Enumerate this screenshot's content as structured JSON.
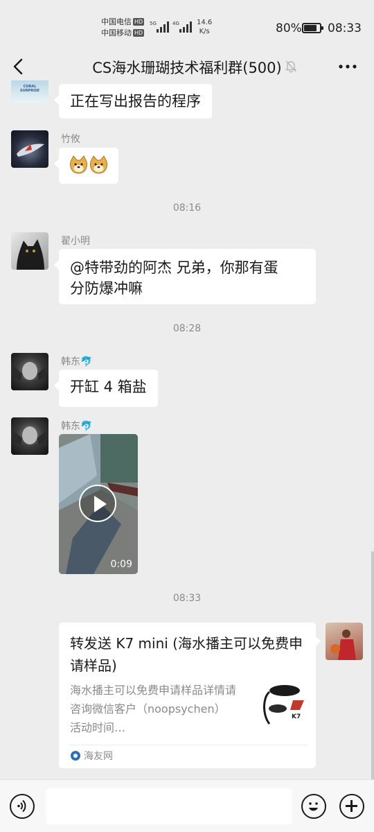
{
  "status_bar": {
    "carrier_1": "中国电信",
    "carrier_2": "中国移动",
    "hd_label": "HD",
    "net_1": "5G",
    "net_2": "4G",
    "speed_value": "14.6",
    "speed_unit": "K/s",
    "battery_percent": "80%",
    "battery_level": 0.8,
    "time": "08:33"
  },
  "header": {
    "title": "CS海水珊瑚技术福利群(500)",
    "icons": [
      "back-arrow-icon",
      "mute-bell-icon",
      "more-dots-icon"
    ]
  },
  "messages": {
    "m0": {
      "text": "正在写出报告的程序",
      "avatar_caption": "CORAL SURPRISE"
    },
    "m1": {
      "sender": "竹攸",
      "content": "emoji",
      "icons": [
        "doge-emoji-icon",
        "doge-emoji-icon"
      ]
    },
    "t1": "08:16",
    "m2": {
      "sender": "翟小明",
      "text_line_1": "@特带劲的阿杰  兄弟，你那有蛋",
      "text_line_2": "分防爆冲嘛"
    },
    "t2": "08:28",
    "m3": {
      "sender": "韩东🐬",
      "text": "开缸 4 箱盐"
    },
    "m4": {
      "sender": "韩东🐬",
      "video_duration": "0:09"
    },
    "t3": "08:33",
    "m5": {
      "title": "转发送 K7 mini (海水播主可以免费申请样品)",
      "description": "海水播主可以免费申请样品详情请咨询微信客户（noopsychen）活动时间…",
      "source": "海友网",
      "thumb_brand": "K7"
    }
  },
  "input_bar": {
    "placeholder": "",
    "icons": [
      "voice-icon",
      "emoji-icon",
      "plus-icon"
    ]
  }
}
